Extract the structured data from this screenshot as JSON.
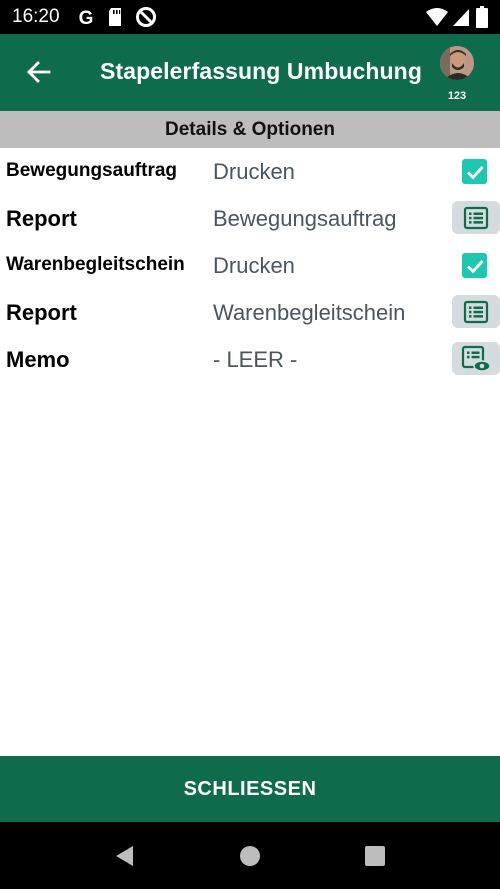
{
  "status_bar": {
    "time": "16:20",
    "icons": [
      "google-icon",
      "sd-card-icon",
      "do-not-disturb-icon",
      "wifi-icon",
      "signal-icon",
      "battery-icon"
    ]
  },
  "app_bar": {
    "title": "Stapelerfassung Umbuchung",
    "user_badge": "123",
    "color": "#0e6b4c"
  },
  "section": {
    "title": "Details & Optionen"
  },
  "rows": [
    {
      "label": "Bewegungsauftrag",
      "value": "Drucken",
      "control": "checkbox",
      "checked": true
    },
    {
      "label": "Report",
      "value": "Bewegungsauftrag",
      "control": "list-icon"
    },
    {
      "label": "Warenbegleitschein",
      "value": "Drucken",
      "control": "checkbox",
      "checked": true
    },
    {
      "label": "Report",
      "value": "Warenbegleitschein",
      "control": "list-icon"
    },
    {
      "label": "Memo",
      "value": "- LEER -",
      "control": "list-eye-icon"
    }
  ],
  "footer": {
    "close_label": "SCHLIESSEN"
  },
  "colors": {
    "accent": "#0e6b4c",
    "checkbox": "#1ec7b0",
    "header_gray": "#bdbdbd",
    "icon_button_bg": "#d6dbdf"
  }
}
